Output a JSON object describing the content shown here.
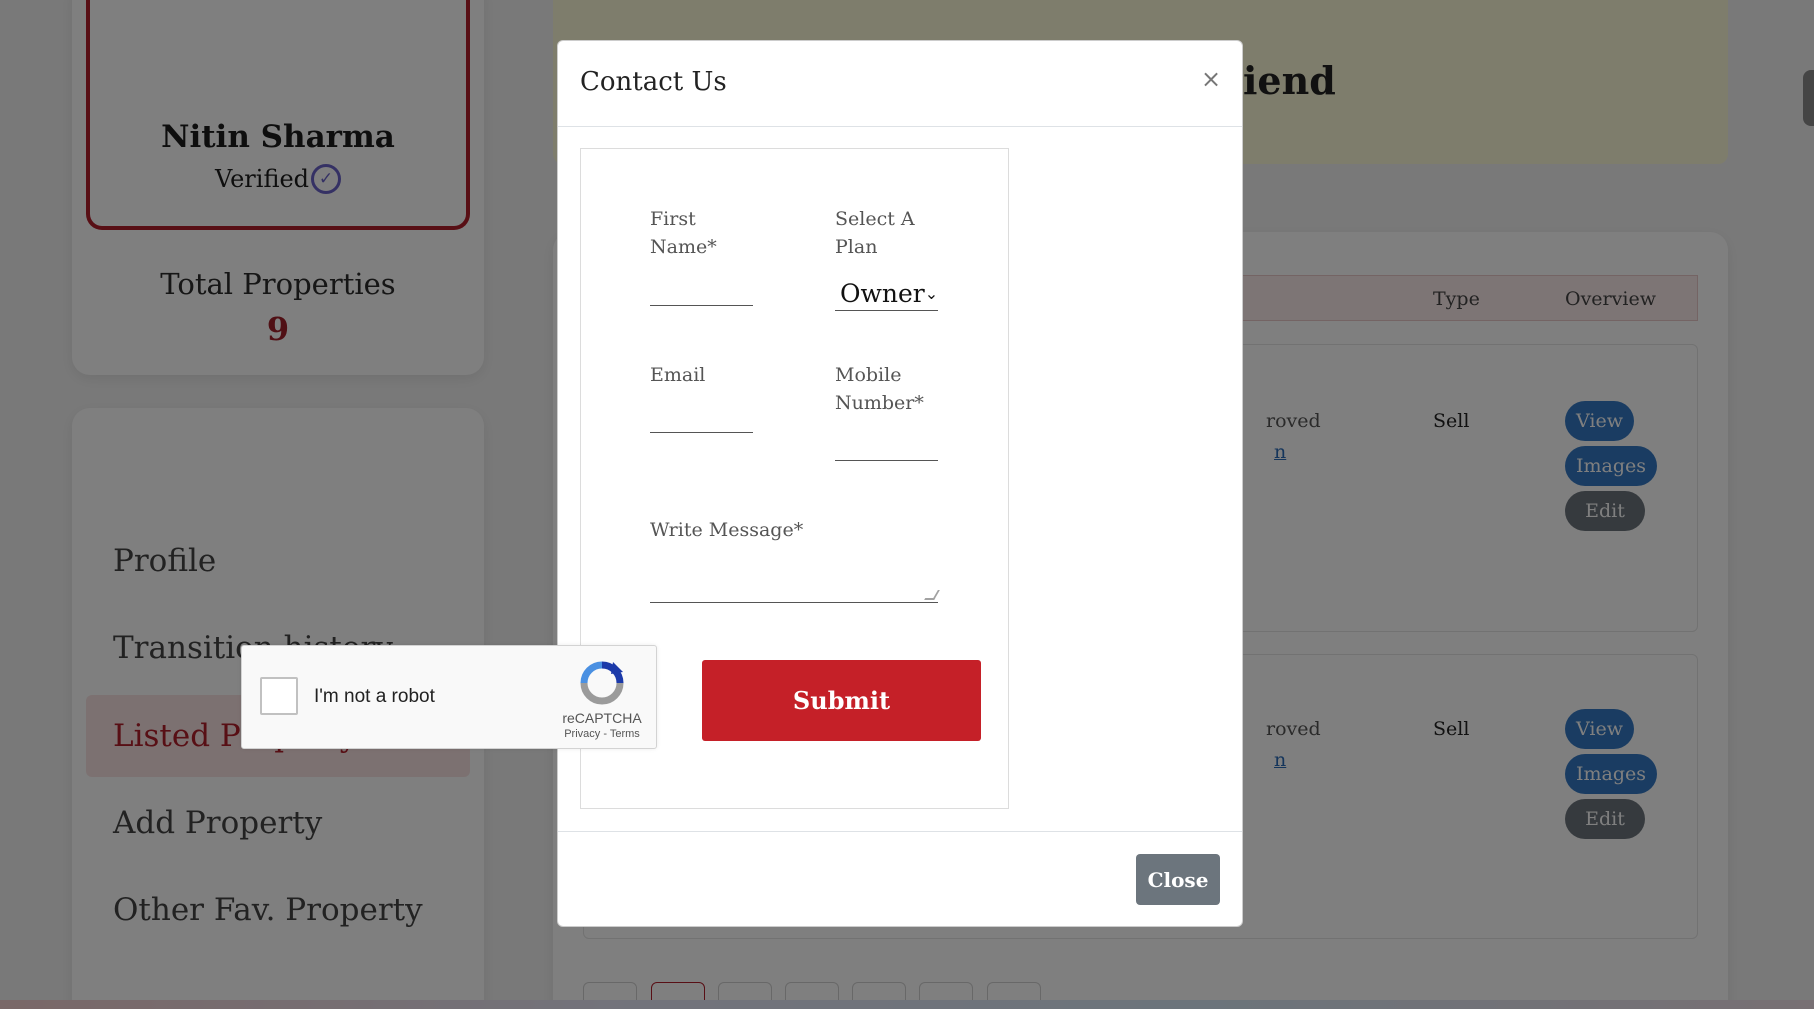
{
  "profile": {
    "name": "Nitin Sharma",
    "verified_label": "Verified",
    "verified_icon": "check-circle-icon",
    "total_properties_label": "Total Properties",
    "total_properties_value": "9"
  },
  "sidebar": {
    "items": [
      {
        "label": "Profile",
        "active": false
      },
      {
        "label": "Transition history",
        "active": false
      },
      {
        "label": "Listed Property",
        "active": true
      },
      {
        "label": "Add Property",
        "active": false
      },
      {
        "label": "Other Fav. Property",
        "active": false
      }
    ]
  },
  "banner": {
    "title_visible": "iend"
  },
  "property_table": {
    "headers": {
      "type": "Type",
      "overview": "Overview"
    },
    "rows": [
      {
        "status": "roved",
        "link": "n",
        "type": "Sell",
        "view": "View",
        "images": "Images",
        "edit": "Edit"
      },
      {
        "status": "roved",
        "link": "n",
        "type": "Sell",
        "view": "View",
        "images": "Images",
        "edit": "Edit"
      }
    ]
  },
  "modal": {
    "title": "Contact Us",
    "close_x": "×",
    "first_name_label": "First Name*",
    "plan_label": "Select A Plan",
    "plan_selected": "Owner",
    "email_label": "Email",
    "mobile_label": "Mobile Number*",
    "message_label": "Write Message*",
    "submit_label": "Submit",
    "close_label": "Close"
  },
  "recaptcha": {
    "label": "I'm not a robot",
    "brand": "reCAPTCHA",
    "privacy": "Privacy",
    "separator": " - ",
    "terms": "Terms"
  },
  "colors": {
    "brand_red": "#c52028",
    "pill_blue": "#3579c4",
    "pill_grey": "#6c757d",
    "banner_yellow": "#fdfbd8"
  }
}
